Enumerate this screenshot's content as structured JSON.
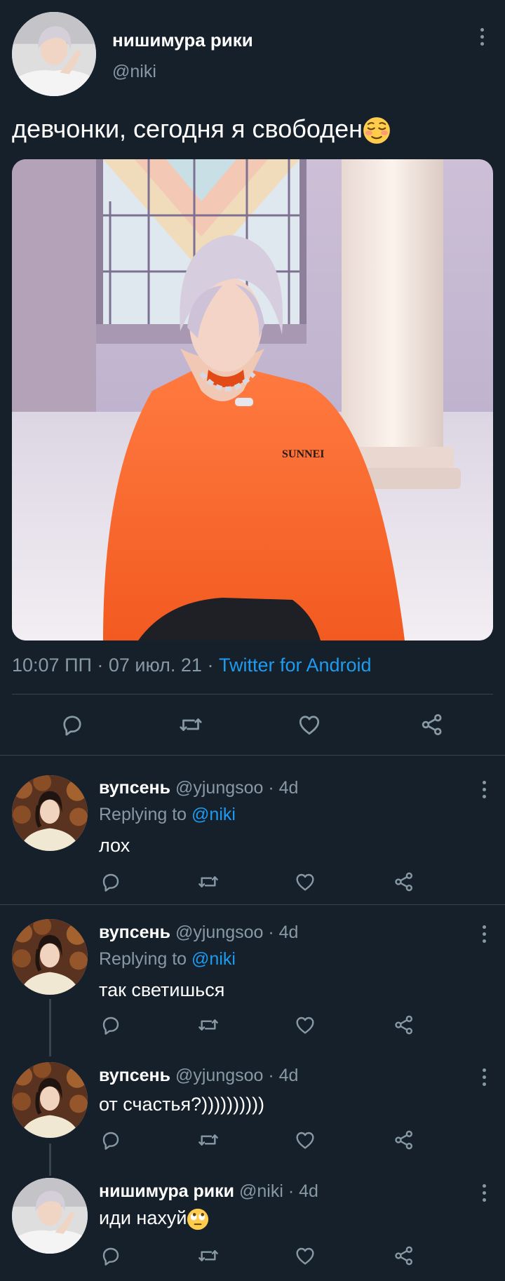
{
  "main_tweet": {
    "name": "нишимура рики",
    "handle": "@niki",
    "text": "девчонки, сегодня я свободен",
    "text_emoji": "relieved-face",
    "time": "10:07 ПП",
    "dot1": " · ",
    "date": "07 июл. 21",
    "dot2": " · ",
    "source": "Twitter for Android"
  },
  "replies": [
    {
      "name": "вупсень",
      "handle": "@yjungsoo",
      "age": " · 4d",
      "replying_prefix": "Replying to ",
      "replying_to": "@niki",
      "text": "лох"
    },
    {
      "name": "вупсень",
      "handle": "@yjungsoo",
      "age": " · 4d",
      "replying_prefix": "Replying to ",
      "replying_to": "@niki",
      "text": "так светишься"
    },
    {
      "name": "вупсень",
      "handle": "@yjungsoo",
      "age": " · 4d",
      "text": "от счастья?))))))))))"
    },
    {
      "name": "нишимура рики",
      "handle": "@niki",
      "age": " · 4d",
      "text": "иди нахуй",
      "text_emoji": "face-with-rolling-eyes"
    }
  ],
  "colors": {
    "background": "#15202b",
    "muted": "#8899a6",
    "accent": "#1d9bf0",
    "divider": "#38444d"
  },
  "icons": [
    "reply-icon",
    "retweet-icon",
    "like-icon",
    "share-icon",
    "more-icon"
  ]
}
